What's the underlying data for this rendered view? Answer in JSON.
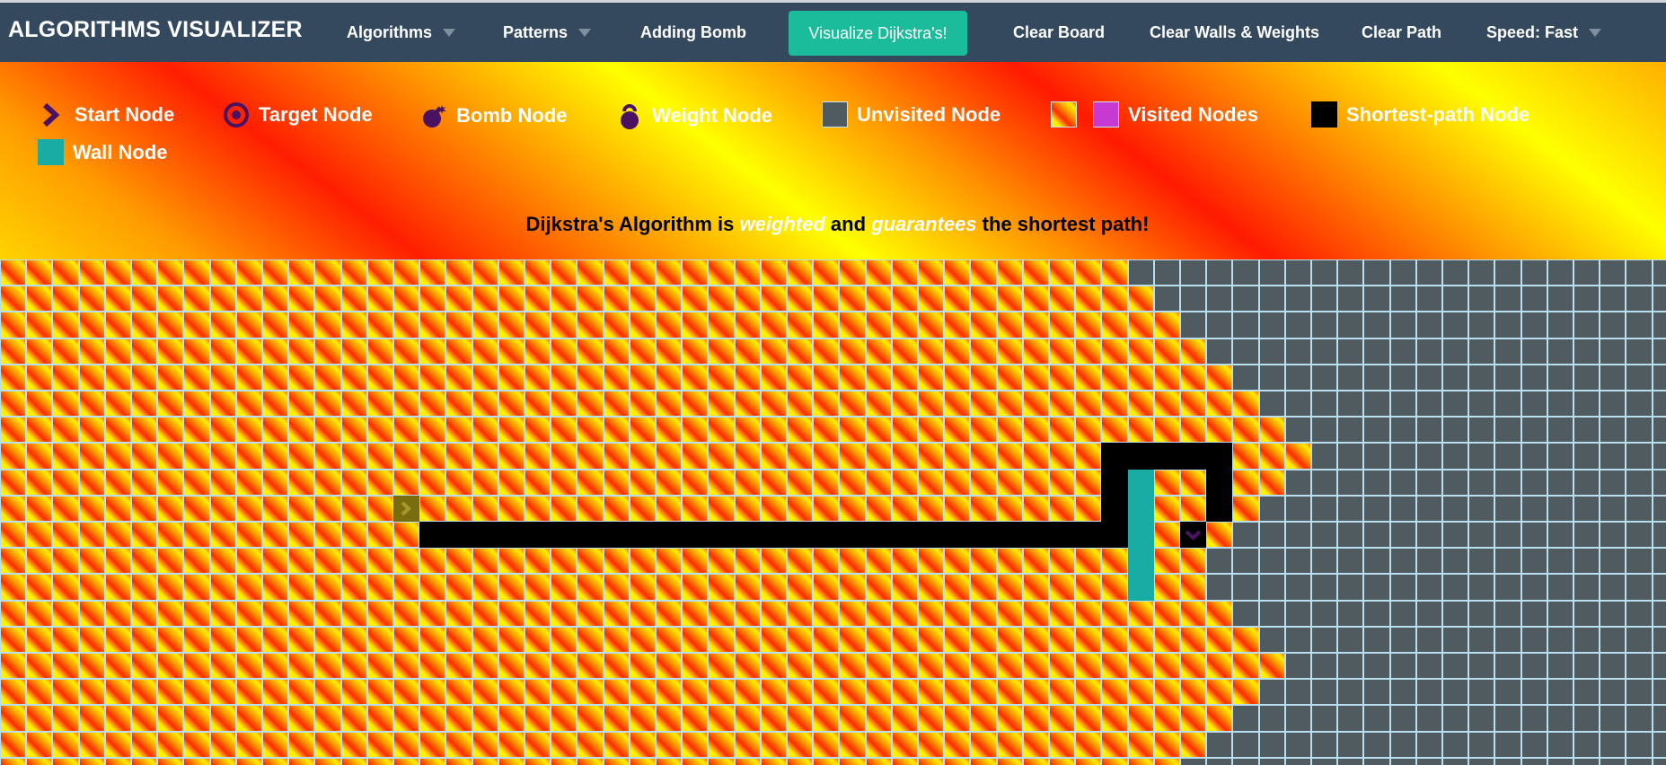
{
  "app": {
    "title": "ALGORITHMS VISUALIZER"
  },
  "nav": {
    "algorithms": "Algorithms",
    "patterns": "Patterns",
    "adding_bomb": "Adding Bomb",
    "visualize": "Visualize Dijkstra's!",
    "clear_board": "Clear Board",
    "clear_walls_weights": "Clear Walls & Weights",
    "clear_path": "Clear Path",
    "speed": "Speed: Fast"
  },
  "legend": {
    "start": "Start Node",
    "target": "Target Node",
    "bomb": "Bomb Node",
    "weight": "Weight Node",
    "unvisited": "Unvisited Node",
    "visited": "Visited Nodes",
    "shortest": "Shortest-path Node",
    "wall": "Wall Node"
  },
  "description": {
    "prefix": "Dijkstra's Algorithm is ",
    "em1": "weighted",
    "middle": " and ",
    "em2": "guarantees",
    "suffix": " the shortest path!"
  },
  "colors": {
    "navbar": "#34495e",
    "accent": "#1abc9c",
    "unvisited": "#4f5b5f",
    "wall": "#19aca4",
    "path": "#000000",
    "visited_alt": "#c73ad1",
    "node_icon": "#4a1260"
  },
  "icons": {
    "start": "chevron-right-icon",
    "target": "target-circle-icon",
    "bomb": "bomb-icon",
    "weight": "kettlebell-icon"
  },
  "board": {
    "cols": 64,
    "rows": 20,
    "visited_boundary": [
      43,
      44,
      45,
      46,
      47,
      48,
      49,
      50,
      49,
      48,
      47,
      46,
      46,
      47,
      48,
      49,
      48,
      47,
      46,
      45
    ],
    "start": [
      9,
      15
    ],
    "target": [
      10,
      45
    ],
    "path": [
      [
        10,
        16
      ],
      [
        10,
        17
      ],
      [
        10,
        18
      ],
      [
        10,
        19
      ],
      [
        10,
        20
      ],
      [
        10,
        21
      ],
      [
        10,
        22
      ],
      [
        10,
        23
      ],
      [
        10,
        24
      ],
      [
        10,
        25
      ],
      [
        10,
        26
      ],
      [
        10,
        27
      ],
      [
        10,
        28
      ],
      [
        10,
        29
      ],
      [
        10,
        30
      ],
      [
        10,
        31
      ],
      [
        10,
        32
      ],
      [
        10,
        33
      ],
      [
        10,
        34
      ],
      [
        10,
        35
      ],
      [
        10,
        36
      ],
      [
        10,
        37
      ],
      [
        10,
        38
      ],
      [
        10,
        39
      ],
      [
        10,
        40
      ],
      [
        10,
        41
      ],
      [
        10,
        42
      ],
      [
        9,
        42
      ],
      [
        8,
        42
      ],
      [
        7,
        42
      ],
      [
        7,
        43
      ],
      [
        7,
        44
      ],
      [
        7,
        45
      ],
      [
        7,
        46
      ],
      [
        8,
        46
      ],
      [
        9,
        46
      ]
    ],
    "walls": [
      [
        8,
        43
      ],
      [
        9,
        43
      ],
      [
        10,
        43
      ],
      [
        11,
        43
      ],
      [
        12,
        43
      ]
    ]
  }
}
